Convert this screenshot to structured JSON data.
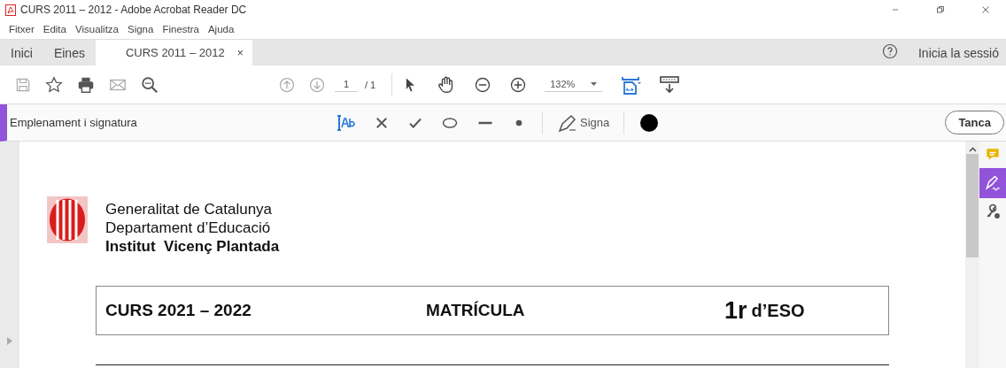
{
  "window": {
    "title": "CURS 2011 – 2012 - Adobe Acrobat Reader DC"
  },
  "menu": [
    "Fitxer",
    "Edita",
    "Visualitza",
    "Signa",
    "Finestra",
    "Ajuda"
  ],
  "tabs": [
    {
      "label": "Inici",
      "selected": false,
      "closable": false
    },
    {
      "label": "Eines",
      "selected": false,
      "closable": false
    },
    {
      "label": "CURS 2011 – 2012",
      "selected": true,
      "closable": true
    }
  ],
  "close_tab": "×",
  "sign_in": "Inicia la sessió",
  "toolbar": {
    "page": "1",
    "page_total": "/ 1",
    "zoom": "132%"
  },
  "fill_sign": {
    "title": "Emplenament i signatura",
    "sign": "Signa",
    "close": "Tanca"
  },
  "side_panel": [
    {
      "kind": "comment",
      "selected": false
    },
    {
      "kind": "sign",
      "selected": true
    },
    {
      "kind": "tools",
      "selected": false
    }
  ],
  "document": {
    "header_lines": [
      {
        "text": "Generalitat de Catalunya",
        "bold": false
      },
      {
        "text": "Departament d’Educació",
        "bold": false
      },
      {
        "text": "Institut  Vicenç Plantada",
        "bold": true
      }
    ],
    "course": "CURS 2021 – 2022",
    "heading": "MATRÍCULA",
    "grade_number": "1r",
    "grade_rest": "d’ESO"
  }
}
